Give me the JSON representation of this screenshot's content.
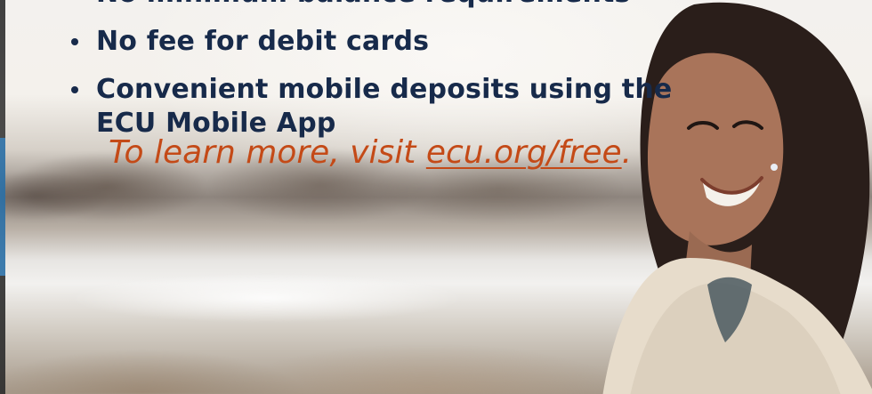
{
  "promo": {
    "bullets": [
      {
        "text": "No minimum balance requirements"
      },
      {
        "text": "No fee for debit cards"
      },
      {
        "text": "Convenient mobile deposits using the ECU Mobile App"
      }
    ],
    "cta": {
      "prefix": "To learn more, visit ",
      "link_text": "ecu.org/free",
      "suffix": "."
    }
  },
  "colors": {
    "navy_text": "#172a4a",
    "accent_orange": "#c44a17"
  }
}
